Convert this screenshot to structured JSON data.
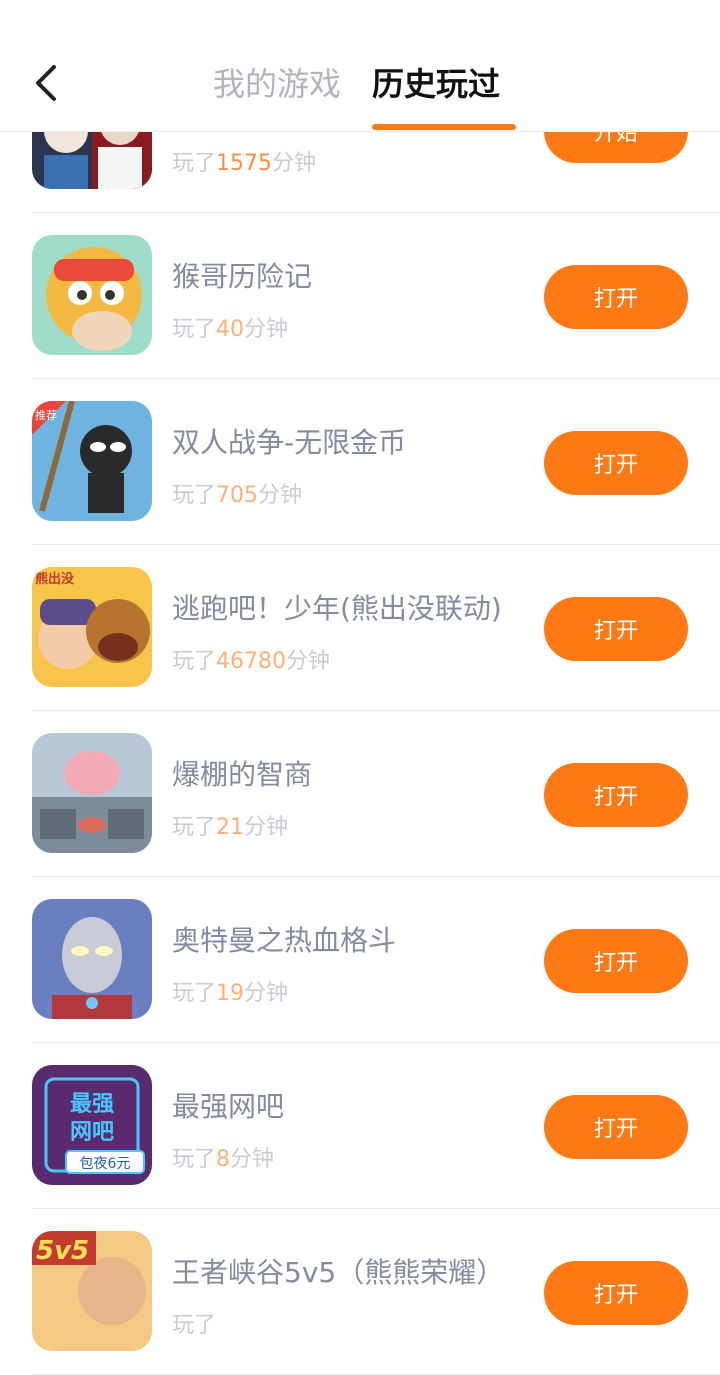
{
  "header": {
    "tab_mygames": "我的游戏",
    "tab_history": "历史玩过"
  },
  "games": [
    {
      "name": "",
      "prefix": "玩了",
      "minutes": "1575",
      "suffix": "分钟",
      "button": "开始"
    },
    {
      "name": "猴哥历险记",
      "prefix": "玩了",
      "minutes": "40",
      "suffix": "分钟",
      "button": "打开"
    },
    {
      "name": "双人战争-无限金币",
      "prefix": "玩了",
      "minutes": "705",
      "suffix": "分钟",
      "button": "打开",
      "badge": "推荐"
    },
    {
      "name": "逃跑吧！少年(熊出没联动)",
      "prefix": "玩了",
      "minutes": "46780",
      "suffix": "分钟",
      "button": "打开",
      "badge": "熊出没"
    },
    {
      "name": "爆棚的智商",
      "prefix": "玩了",
      "minutes": "21",
      "suffix": "分钟",
      "button": "打开"
    },
    {
      "name": "奥特曼之热血格斗",
      "prefix": "玩了",
      "minutes": "19",
      "suffix": "分钟",
      "button": "打开"
    },
    {
      "name": "最强网吧",
      "prefix": "玩了",
      "minutes": "8",
      "suffix": "分钟",
      "button": "打开",
      "icon_text_1": "最强",
      "icon_text_2": "网吧",
      "icon_text_3": "包夜6元"
    },
    {
      "name": "王者峡谷5v5（熊熊荣耀）",
      "prefix": "玩了",
      "minutes": "",
      "suffix": "",
      "button": "打开",
      "badge": "5v5"
    }
  ],
  "colors": {
    "accent": "#ff7a14",
    "active_tab": "#111111",
    "inactive_tab": "#b3b3bd"
  }
}
